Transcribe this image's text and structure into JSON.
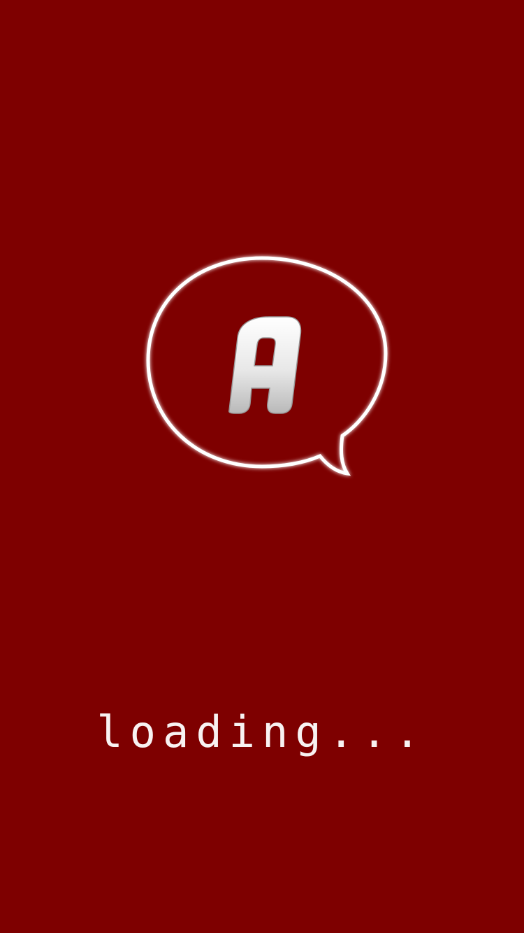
{
  "app": {
    "logo_letter": "A",
    "logo_icon": "speech-bubble-icon",
    "loading_label": "loading...",
    "background_color": "#7e0000",
    "accent_color": "#ffffff"
  }
}
